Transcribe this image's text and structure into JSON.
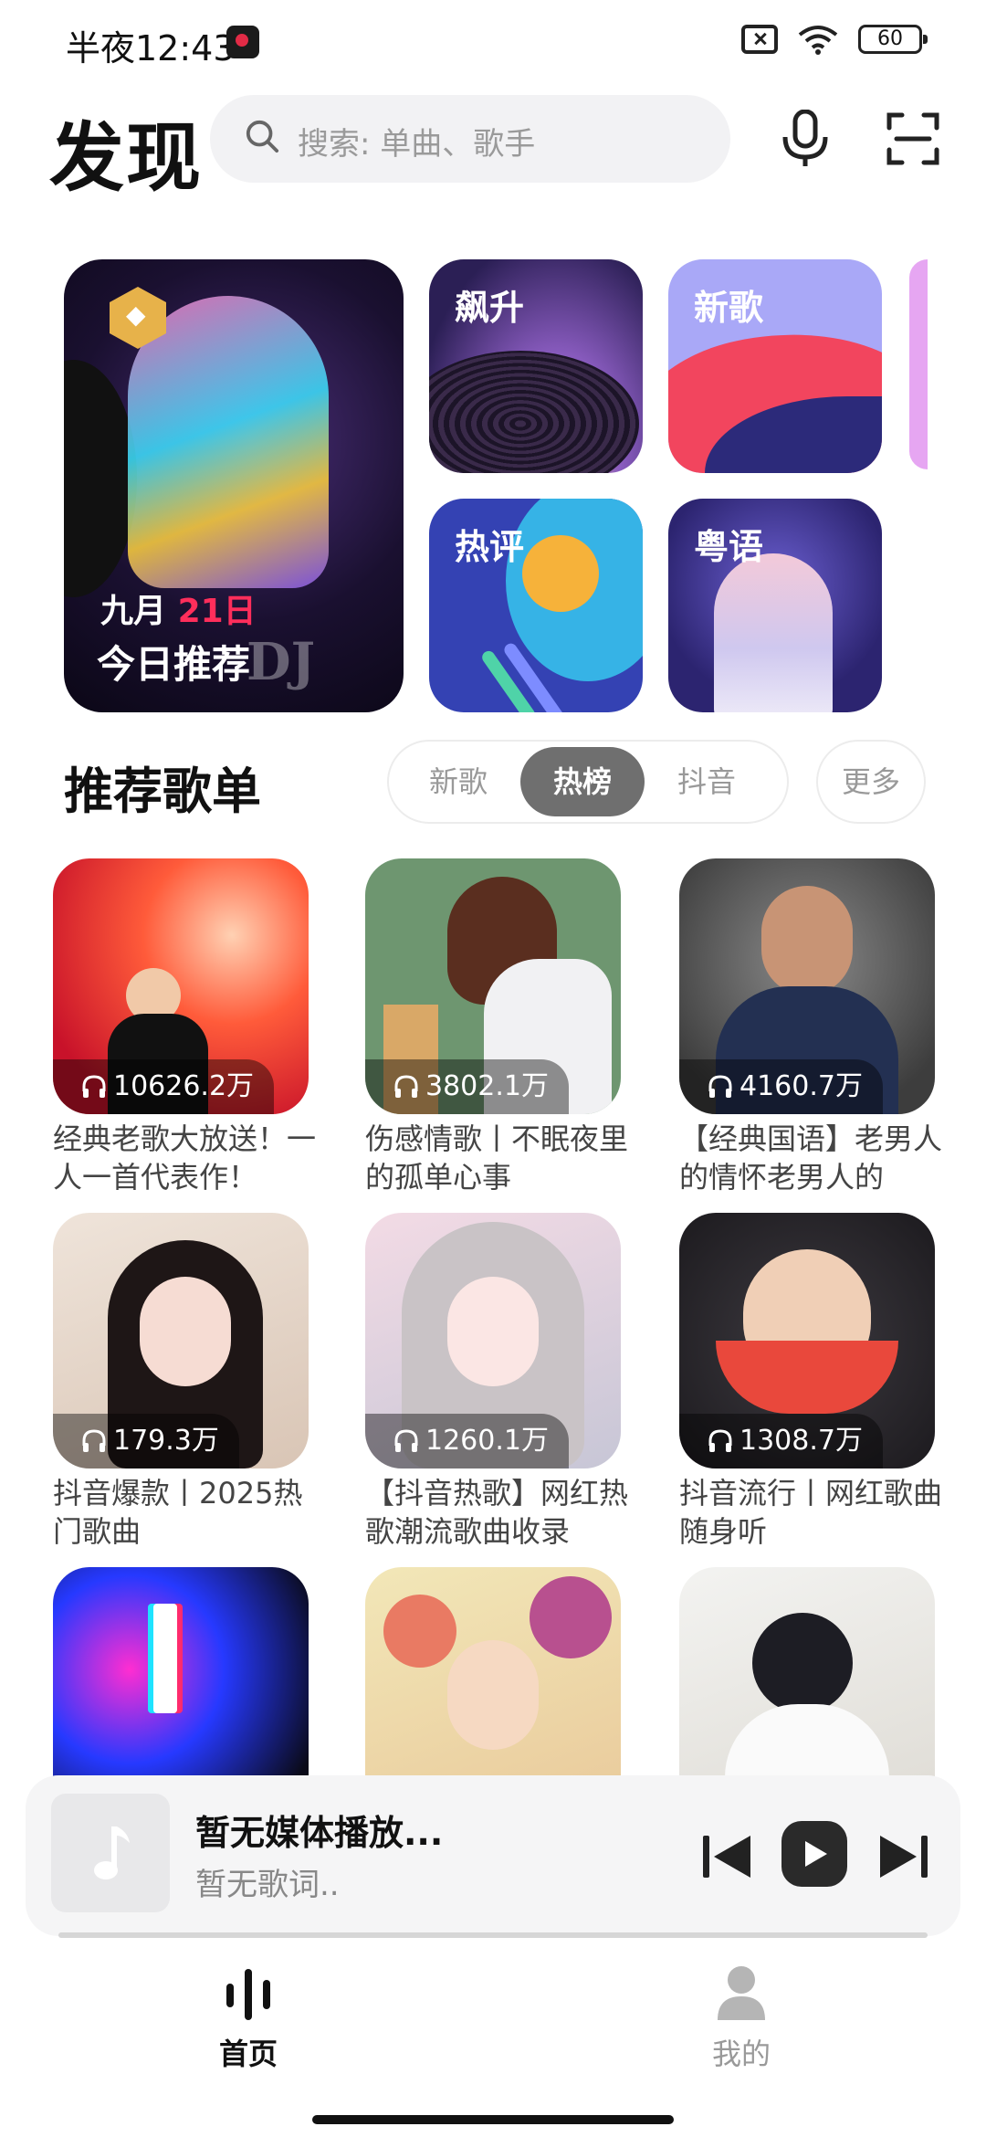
{
  "status": {
    "time": "半夜12:43",
    "battery": "60"
  },
  "header": {
    "title": "发现",
    "search_placeholder": "搜索: 单曲、歌手"
  },
  "featured": {
    "main": {
      "month": "九月",
      "day": "21日",
      "label": "今日推荐",
      "watermark": "DJ"
    },
    "tiles": [
      {
        "label": "飙升"
      },
      {
        "label": "新歌"
      },
      {
        "label": "热评"
      },
      {
        "label": "粤语"
      }
    ]
  },
  "section": {
    "title": "推荐歌单",
    "tabs": [
      "新歌",
      "热榜",
      "抖音"
    ],
    "active_tab": "热榜",
    "more": "更多"
  },
  "playlists": [
    {
      "count": "10626.2万",
      "title": "经典老歌大放送！一人一首代表作！"
    },
    {
      "count": "3802.1万",
      "title": "伤感情歌丨不眠夜里的孤单心事"
    },
    {
      "count": "4160.7万",
      "title": "【经典国语】老男人的情怀老男人的"
    },
    {
      "count": "179.3万",
      "title": "抖音爆款丨2025热门歌曲"
    },
    {
      "count": "1260.1万",
      "title": "【抖音热歌】网红热歌潮流歌曲收录"
    },
    {
      "count": "1308.7万",
      "title": "抖音流行丨网红歌曲随身听"
    },
    {
      "count": "",
      "title": ""
    },
    {
      "count": "",
      "title": ""
    },
    {
      "count": "",
      "title": ""
    }
  ],
  "player": {
    "title": "暂无媒体播放...",
    "lyric": "暂无歌词.."
  },
  "nav": {
    "home": "首页",
    "mine": "我的"
  }
}
